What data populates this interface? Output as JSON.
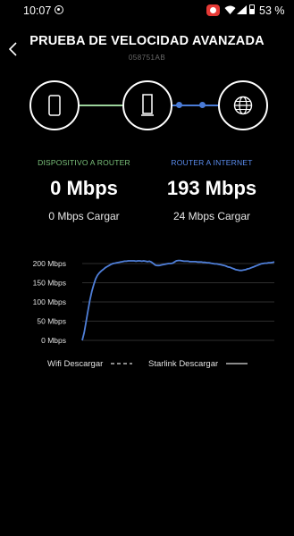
{
  "status_bar": {
    "time": "10:07",
    "battery": "53 %"
  },
  "header": {
    "title": "PRUEBA DE VELOCIDAD AVANZADA",
    "serial": "058751AB"
  },
  "topology": {
    "nodes": [
      "phone-icon",
      "router-icon",
      "globe-icon"
    ],
    "link_colors": {
      "device_router": "#9bd29b",
      "router_internet": "#4a7bd6"
    }
  },
  "segments": {
    "device_to_router": {
      "label": "DISPOSITIVO A ROUTER",
      "color": "#7cc37c",
      "download": "0 Mbps",
      "upload": "0 Mbps Cargar"
    },
    "router_to_internet": {
      "label": "ROUTER A INTERNET",
      "color": "#5b8def",
      "download": "193 Mbps",
      "upload": "24 Mbps Cargar"
    }
  },
  "legend": {
    "wifi": "Wifi Descargar",
    "starlink": "Starlink Descargar"
  },
  "chart_data": {
    "type": "line",
    "ylim": [
      0,
      200
    ],
    "ytick_values": [
      0,
      50,
      100,
      150,
      200
    ],
    "ytick_labels": [
      "0 Mbps",
      "50 Mbps",
      "100 Mbps",
      "150 Mbps",
      "200 Mbps"
    ],
    "grid": true,
    "series": [
      {
        "name": "Starlink Descargar",
        "color": "#4f7fd9",
        "x": [
          0,
          1,
          2,
          3,
          4,
          5,
          6,
          7,
          8,
          9,
          10,
          11,
          12,
          13,
          14,
          15,
          16,
          17,
          18,
          19,
          20,
          21,
          22,
          23,
          24,
          25,
          26,
          27,
          28,
          29,
          30,
          31,
          32,
          33,
          34,
          35,
          36,
          37,
          38,
          39,
          40,
          41,
          42,
          43,
          44,
          45,
          46,
          47,
          48,
          49,
          50,
          51,
          52,
          53,
          54,
          55,
          56,
          57,
          58,
          59,
          60,
          61,
          62,
          63,
          64,
          65,
          66,
          67,
          68,
          69,
          70,
          71,
          72,
          73,
          74,
          75,
          76,
          77,
          78,
          79,
          80,
          81,
          82,
          83,
          84,
          85,
          86,
          87,
          88,
          89,
          90,
          91,
          92,
          93,
          94,
          95,
          96,
          97,
          98,
          99,
          100
        ],
        "values": [
          0,
          20,
          48,
          78,
          105,
          128,
          145,
          160,
          170,
          176,
          181,
          185,
          189,
          192,
          195,
          198,
          200,
          201,
          202,
          203,
          204,
          205,
          206,
          206,
          207,
          207,
          207,
          207,
          206,
          207,
          207,
          206,
          207,
          206,
          205,
          206,
          204,
          200,
          196,
          195,
          195,
          196,
          197,
          198,
          199,
          200,
          200,
          201,
          204,
          207,
          208,
          208,
          207,
          206,
          206,
          206,
          205,
          205,
          205,
          205,
          204,
          204,
          204,
          203,
          203,
          202,
          202,
          201,
          200,
          199,
          199,
          198,
          197,
          196,
          195,
          193,
          191,
          190,
          188,
          186,
          184,
          183,
          182,
          182,
          183,
          184,
          186,
          187,
          189,
          191,
          193,
          195,
          197,
          199,
          200,
          201,
          201,
          202,
          202,
          203,
          204
        ]
      },
      {
        "name": "Wifi Descargar",
        "color": "#dddddd",
        "x": [],
        "values": []
      }
    ]
  }
}
